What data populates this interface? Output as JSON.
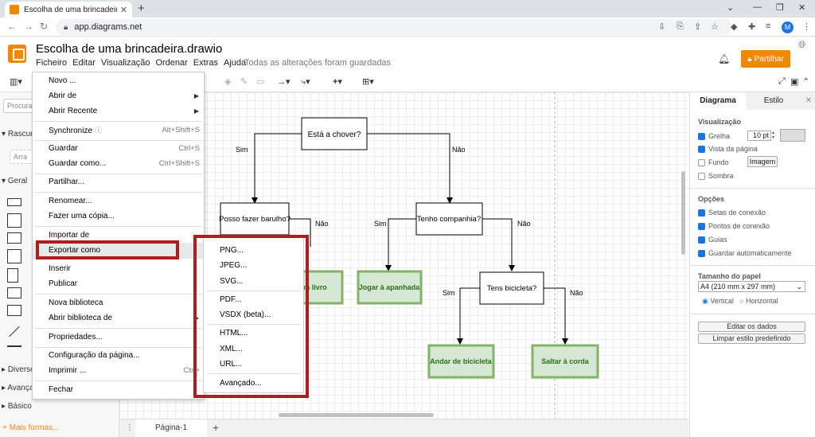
{
  "browser": {
    "tab_title": "Escolha de uma brincadeira.drawio",
    "url": "app.diagrams.net",
    "profile_initial": "M"
  },
  "app": {
    "title": "Escolha de uma brincadeira.drawio",
    "menus": [
      "Ficheiro",
      "Editar",
      "Visualização",
      "Ordenar",
      "Extras",
      "Ajuda"
    ],
    "save_status": "Todas as alterações foram guardadas",
    "share_label": "Partilhar"
  },
  "sidebar": {
    "search_placeholder": "Procurar",
    "sections": [
      "Rascun",
      "Geral",
      "Diverso",
      "Avançad",
      "Básico"
    ],
    "drag_hint": "Arra",
    "more_shapes": "+ Mais formas..."
  },
  "file_menu": {
    "items": [
      {
        "label": "Novo ...",
        "shortcut": ""
      },
      {
        "label": "Abrir de",
        "shortcut": "",
        "submenu": true
      },
      {
        "label": "Abrir Recente",
        "shortcut": "",
        "submenu": true
      },
      {
        "label": "Synchronize",
        "shortcut": "Alt+Shift+S"
      },
      {
        "label": "Guardar",
        "shortcut": "Ctrl+S"
      },
      {
        "label": "Guardar como...",
        "shortcut": "Ctrl+Shift+S"
      },
      {
        "label": "Partilhar...",
        "shortcut": ""
      },
      {
        "label": "Renomear...",
        "shortcut": ""
      },
      {
        "label": "Fazer uma cópia...",
        "shortcut": ""
      },
      {
        "label": "Importar de",
        "shortcut": ""
      },
      {
        "label": "Exportar como",
        "shortcut": ""
      },
      {
        "label": "Inserir",
        "shortcut": ""
      },
      {
        "label": "Publicar",
        "shortcut": ""
      },
      {
        "label": "Nova biblioteca",
        "shortcut": ""
      },
      {
        "label": "Abrir biblioteca de",
        "shortcut": ""
      },
      {
        "label": "Propriedades...",
        "shortcut": ""
      },
      {
        "label": "Configuração da página...",
        "shortcut": ""
      },
      {
        "label": "Imprimir ...",
        "shortcut": "Ctrl+"
      },
      {
        "label": "Fechar",
        "shortcut": ""
      }
    ]
  },
  "export_submenu": {
    "items": [
      "PNG...",
      "JPEG...",
      "SVG...",
      "PDF...",
      "VSDX (beta)...",
      "HTML...",
      "XML...",
      "URL...",
      "Avançado..."
    ]
  },
  "diagram": {
    "nodes": {
      "q1": "Está a chover?",
      "q2": "Posso fazer barulho?",
      "q3": "Tenho companhia?",
      "q4": "Tens bicicleta?",
      "a1": "m livro",
      "a2": "Jogar à apanhada",
      "a3": "Andar de bicicleta",
      "a4": "Saltar à corda"
    },
    "edge_labels": {
      "sim": "Sim",
      "nao": "Não"
    }
  },
  "format_panel": {
    "tabs": [
      "Diagrama",
      "Estilo"
    ],
    "view_heading": "Visualização",
    "grid_label": "Grelha",
    "grid_size": "10 pt",
    "page_view": "Vista da página",
    "background": "Fundo",
    "image_button": "Imagem",
    "shadow": "Sombra",
    "options_heading": "Opções",
    "connection_arrows": "Setas de conexão",
    "connection_points": "Pontos de conexão",
    "guides": "Guias",
    "autosave": "Guardar automaticamente",
    "paper_heading": "Tamanho do papel",
    "paper_size": "A4 (210 mm x 297 mm)",
    "portrait": "Vertical",
    "landscape": "Horizontal",
    "edit_data": "Editar os dados",
    "clear_style": "Limpar estilo predefinido"
  },
  "pages": {
    "current": "Página-1"
  },
  "colors": {
    "accent": "#f08705",
    "highlight": "#b01d1d",
    "leaf_fill": "#d5e8d4",
    "leaf_stroke": "#82b366",
    "leaf_text": "#2d6e1f"
  }
}
